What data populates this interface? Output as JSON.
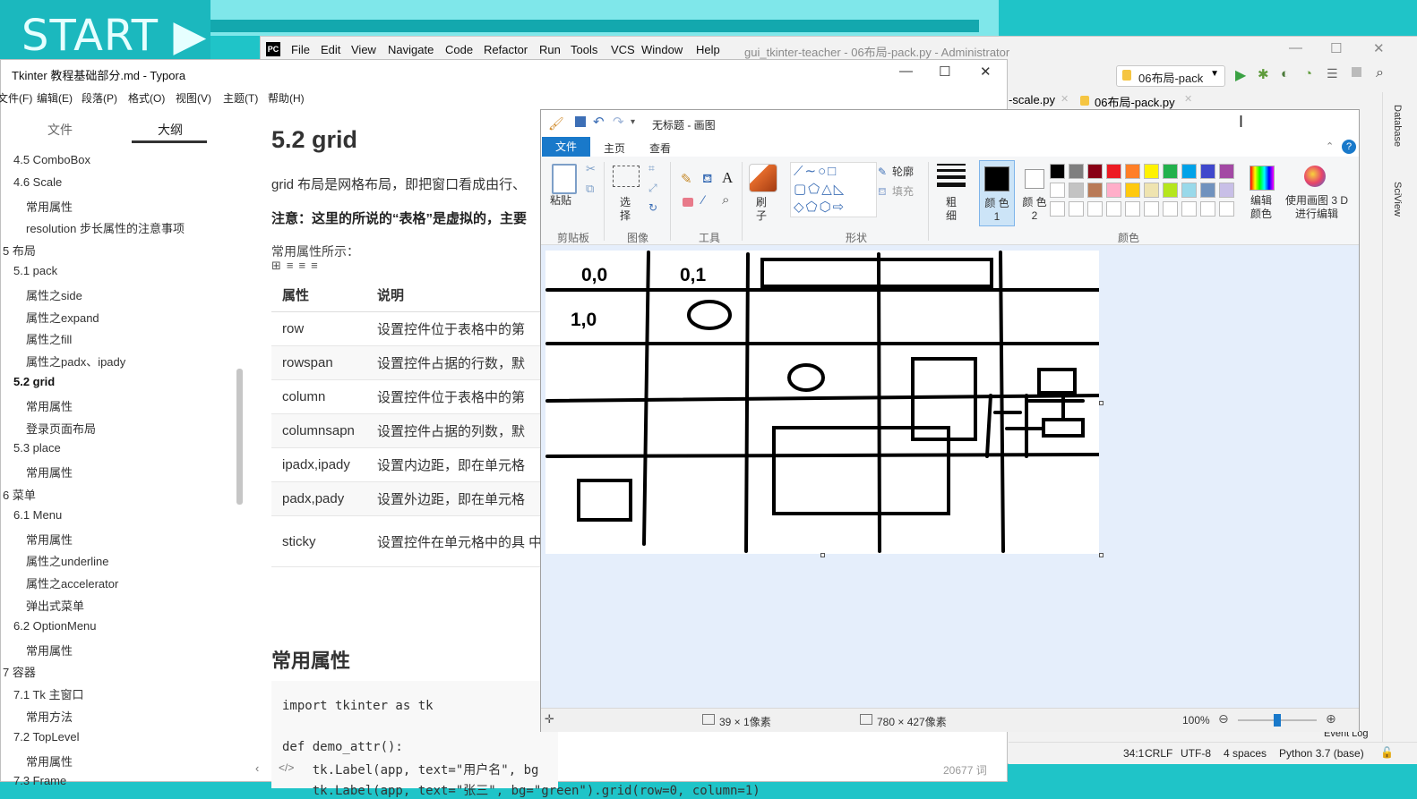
{
  "background": {
    "banner_text": "START ▶"
  },
  "pycharm": {
    "menu": [
      "File",
      "Edit",
      "View",
      "Navigate",
      "Code",
      "Refactor",
      "Run",
      "Tools",
      "VCS",
      "Window",
      "Help"
    ],
    "title": "gui_tkinter-teacher - 06布局-pack.py - Administrator",
    "run_config": "06布局-pack",
    "tabs": [
      "-scale.py",
      "06布局-pack.py"
    ],
    "side_tools": [
      "Database",
      "SciView"
    ],
    "status": {
      "position": "34:1",
      "line_sep": "CRLF",
      "encoding": "UTF-8",
      "indent": "4 spaces",
      "interpreter": "Python 3.7 (base)"
    },
    "event_log": "Event Log"
  },
  "typora": {
    "title": "Tkinter 教程基础部分.md - Typora",
    "menu": [
      "文件(F)",
      "编辑(E)",
      "段落(P)",
      "格式(O)",
      "视图(V)",
      "主题(T)",
      "帮助(H)"
    ],
    "sidebar_tabs": {
      "files": "文件",
      "outline": "大纲"
    },
    "outline": [
      {
        "text": "4.5 ComboBox",
        "level": 2
      },
      {
        "text": "4.6 Scale",
        "level": 2
      },
      {
        "text": "常用属性",
        "level": 3
      },
      {
        "text": "resolution 步长属性的注意事项",
        "level": 3
      },
      {
        "text": "5 布局",
        "level": 1
      },
      {
        "text": "5.1 pack",
        "level": 2
      },
      {
        "text": "属性之side",
        "level": 3
      },
      {
        "text": "属性之expand",
        "level": 3
      },
      {
        "text": "属性之fill",
        "level": 3
      },
      {
        "text": "属性之padx、ipady",
        "level": 3
      },
      {
        "text": "5.2 grid",
        "level": 2,
        "active": true
      },
      {
        "text": "常用属性",
        "level": 3
      },
      {
        "text": "登录页面布局",
        "level": 3
      },
      {
        "text": "5.3 place",
        "level": 2
      },
      {
        "text": "常用属性",
        "level": 3
      },
      {
        "text": "6 菜单",
        "level": 1
      },
      {
        "text": "6.1 Menu",
        "level": 2
      },
      {
        "text": "常用属性",
        "level": 3
      },
      {
        "text": "属性之underline",
        "level": 3
      },
      {
        "text": "属性之accelerator",
        "level": 3
      },
      {
        "text": "弹出式菜单",
        "level": 3
      },
      {
        "text": "6.2 OptionMenu",
        "level": 2
      },
      {
        "text": "常用属性",
        "level": 3
      },
      {
        "text": "7 容器",
        "level": 1
      },
      {
        "text": "7.1 Tk 主窗口",
        "level": 2
      },
      {
        "text": "常用方法",
        "level": 3
      },
      {
        "text": "7.2 TopLevel",
        "level": 2
      },
      {
        "text": "常用属性",
        "level": 3
      },
      {
        "text": "7.3 Frame",
        "level": 2
      }
    ],
    "content": {
      "heading": "5.2 grid",
      "para1": "grid 布局是网格布局，即把窗口看成由行、",
      "para2": "注意：这里的所说的“表格”是虚拟的，主要",
      "para3": "常用属性所示：",
      "table_headers": [
        "属性",
        "说明"
      ],
      "table_rows": [
        [
          "row",
          "设置控件位于表格中的第"
        ],
        [
          "rowspan",
          "设置控件占据的行数，默"
        ],
        [
          "column",
          "设置控件位于表格中的第"
        ],
        [
          "columnsapn",
          "设置控件占据的列数，默"
        ],
        [
          "ipadx,ipady",
          "设置内边距，即在单元格"
        ],
        [
          "padx,pady",
          "设置外边距，即在单元格"
        ],
        [
          "sticky",
          "设置控件在单元格中的具 中。"
        ]
      ],
      "heading2": "常用属性",
      "code": [
        "import tkinter as tk",
        "",
        "def demo_attr():",
        "    tk.Label(app, text=\"用户名\", bg",
        "    tk.Label(app, text=\"张三\", bg=\"green\").grid(row=0, column=1)"
      ]
    },
    "word_count": "20677 词"
  },
  "paint": {
    "title": "无标题 - 画图",
    "tabs": {
      "file": "文件",
      "home": "主页",
      "view": "查看"
    },
    "groups": {
      "clipboard": "剪贴板",
      "image": "图像",
      "tools": "工具",
      "shapes": "形状",
      "colors": "颜色"
    },
    "buttons": {
      "paste": "粘贴",
      "select": "选 择",
      "brush": "刷 子",
      "outline": "轮廓",
      "fill": "填充",
      "size": "粗 细",
      "color1": "颜 色 1",
      "color2": "颜 色 2",
      "edit_colors": "编辑 颜色",
      "paint3d": "使用画图 3 D 进行编辑"
    },
    "canvas_labels": [
      "0,0",
      "0,1",
      "1,0"
    ],
    "status": {
      "cursor": "39 × 1像素",
      "size": "780 × 427像素",
      "zoom": "100%"
    },
    "palette_row1": [
      "#000000",
      "#7f7f7f",
      "#880015",
      "#ed1c24",
      "#ff7f27",
      "#fff200",
      "#22b14c",
      "#00a2e8",
      "#3f48cc",
      "#a349a4"
    ],
    "palette_row2": [
      "#ffffff",
      "#c3c3c3",
      "#b97a57",
      "#ffaec9",
      "#ffc90e",
      "#efe4b0",
      "#b5e61d",
      "#99d9ea",
      "#7092be",
      "#c8bfe7"
    ]
  }
}
